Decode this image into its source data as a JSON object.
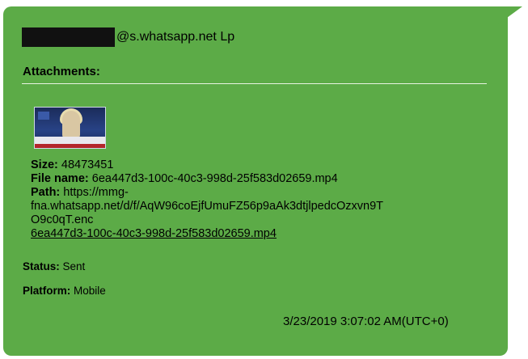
{
  "message": {
    "sender_suffix": "@s.whatsapp.net Lp",
    "attachments_label": "Attachments:",
    "attachment": {
      "size_label": "Size:",
      "size_value": "48473451",
      "filename_label": "File name:",
      "filename_value": "6ea447d3-100c-40c3-998d-25f583d02659.mp4",
      "path_label": "Path:",
      "path_line1": "https://mmg-",
      "path_line2": "fna.whatsapp.net/d/f/AqW96coEjfUmuFZ56p9aAk3dtjlpedcOzxvn9T",
      "path_line3": "O9c0qT.enc",
      "link_text": "6ea447d3-100c-40c3-998d-25f583d02659.mp4"
    },
    "status_label": "Status:",
    "status_value": "Sent",
    "platform_label": "Platform:",
    "platform_value": "Mobile",
    "timestamp": "3/23/2019 3:07:02 AM(UTC+0)"
  },
  "colors": {
    "bubble": "#5cab47",
    "text": "#ffffff",
    "redaction": "#111111"
  },
  "icons": {
    "thumbnail": "video-thumbnail"
  }
}
